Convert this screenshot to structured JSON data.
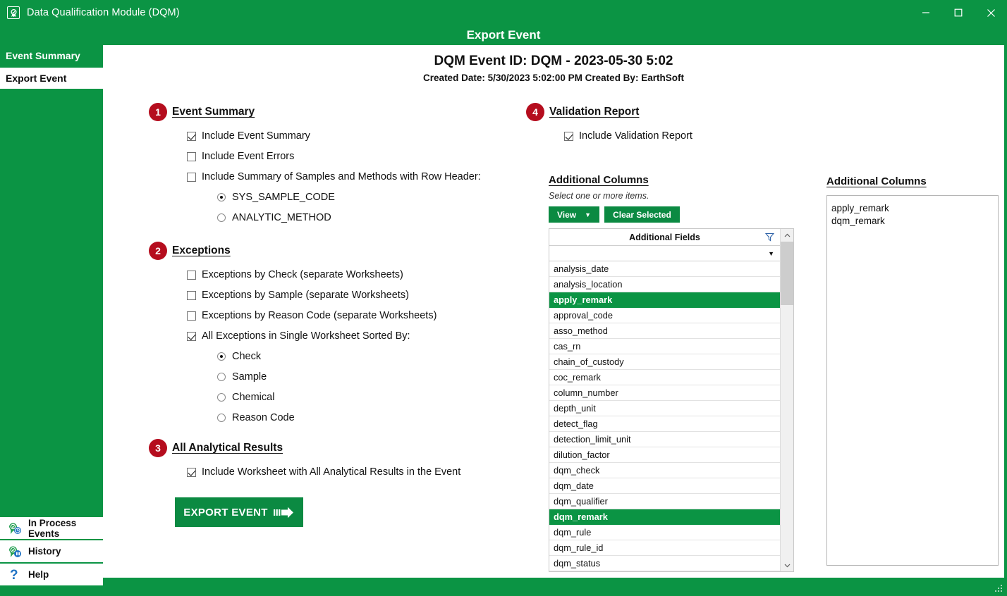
{
  "window": {
    "title": "Data Qualification Module (DQM)",
    "app_icon": "award-badge-icon",
    "minimize": "minimize-icon",
    "maximize": "maximize-icon",
    "close": "close-icon"
  },
  "page": {
    "header_title": "Export Event"
  },
  "sidebar": {
    "items": [
      {
        "label": "Event Summary",
        "state": "active"
      },
      {
        "label": "Export Event",
        "state": "current"
      }
    ],
    "bottom_items": [
      {
        "label": "In Process Events",
        "icon": "in-process-events-icon"
      },
      {
        "label": "History",
        "icon": "history-icon"
      },
      {
        "label": "Help",
        "icon": "help-question-icon"
      }
    ]
  },
  "event": {
    "id_line": "DQM Event ID: DQM - 2023-05-30 5:02",
    "meta_line": "Created Date: 5/30/2023 5:02:00 PM   Created By: EarthSoft"
  },
  "sections": {
    "event_summary": {
      "number": "1",
      "title": "Event Summary",
      "checkboxes": [
        {
          "label": "Include Event Summary",
          "checked": true
        },
        {
          "label": "Include Event Errors",
          "checked": false
        },
        {
          "label": "Include Summary of Samples and Methods with Row Header:",
          "checked": false
        }
      ],
      "radios": [
        {
          "label": "SYS_SAMPLE_CODE",
          "checked": true
        },
        {
          "label": "ANALYTIC_METHOD",
          "checked": false
        }
      ]
    },
    "exceptions": {
      "number": "2",
      "title": "Exceptions",
      "checkboxes": [
        {
          "label": "Exceptions by Check (separate Worksheets)",
          "checked": false
        },
        {
          "label": "Exceptions by Sample (separate Worksheets)",
          "checked": false
        },
        {
          "label": "Exceptions by Reason Code (separate Worksheets)",
          "checked": false
        },
        {
          "label": "All Exceptions in Single Worksheet Sorted By:",
          "checked": true
        }
      ],
      "radios": [
        {
          "label": "Check",
          "checked": true
        },
        {
          "label": "Sample",
          "checked": false
        },
        {
          "label": "Chemical",
          "checked": false
        },
        {
          "label": "Reason Code",
          "checked": false
        }
      ]
    },
    "all_analytical_results": {
      "number": "3",
      "title": "All Analytical Results",
      "checkboxes": [
        {
          "label": "Include Worksheet with All Analytical Results in the Event",
          "checked": true
        }
      ]
    },
    "validation_report": {
      "number": "4",
      "title": "Validation Report",
      "checkboxes": [
        {
          "label": "Include Validation Report",
          "checked": true
        }
      ]
    }
  },
  "export_button": {
    "label": "EXPORT EVENT",
    "icon": "export-arrow-icon"
  },
  "additional_columns_picker": {
    "title": "Additional Columns",
    "hint": "Select one or more items.",
    "view_button": "View",
    "clear_button": "Clear Selected",
    "list_header": "Additional Fields",
    "filter_icon": "funnel-filter-icon",
    "filter_dropdown_icon": "chevron-down-icon",
    "scroll_up_icon": "chevron-up-icon",
    "scroll_down_icon": "chevron-down-icon",
    "rows": [
      {
        "label": "analysis_date",
        "selected": false
      },
      {
        "label": "analysis_location",
        "selected": false
      },
      {
        "label": "apply_remark",
        "selected": true
      },
      {
        "label": "approval_code",
        "selected": false
      },
      {
        "label": "asso_method",
        "selected": false
      },
      {
        "label": "cas_rn",
        "selected": false
      },
      {
        "label": "chain_of_custody",
        "selected": false
      },
      {
        "label": "coc_remark",
        "selected": false
      },
      {
        "label": "column_number",
        "selected": false
      },
      {
        "label": "depth_unit",
        "selected": false
      },
      {
        "label": "detect_flag",
        "selected": false
      },
      {
        "label": "detection_limit_unit",
        "selected": false
      },
      {
        "label": "dilution_factor",
        "selected": false
      },
      {
        "label": "dqm_check",
        "selected": false
      },
      {
        "label": "dqm_date",
        "selected": false
      },
      {
        "label": "dqm_qualifier",
        "selected": false
      },
      {
        "label": "dqm_remark",
        "selected": true
      },
      {
        "label": "dqm_rule",
        "selected": false
      },
      {
        "label": "dqm_rule_id",
        "selected": false
      },
      {
        "label": "dqm_status",
        "selected": false
      }
    ]
  },
  "additional_columns_selected": {
    "title": "Additional Columns",
    "items": [
      "apply_remark",
      "dqm_remark"
    ]
  },
  "colors": {
    "brand_green": "#0b9444",
    "button_green": "#0b8a42",
    "badge_red": "#b50d1e",
    "selection_green": "#0b9444"
  }
}
